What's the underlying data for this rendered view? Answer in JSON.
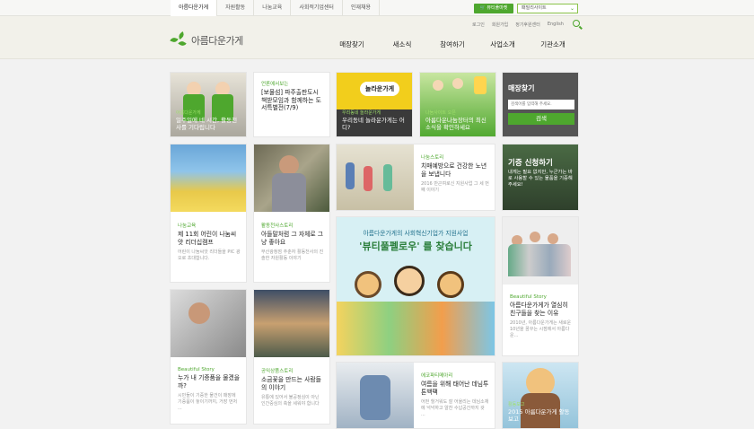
{
  "topbar": {
    "tabs": [
      "아름다운가게",
      "자원활동",
      "나눔교육",
      "사회적기업센터",
      "인재채용"
    ],
    "shop_label": "뷰티풀마켓",
    "site_select": "패밀리사이트"
  },
  "util": {
    "items": [
      "로그인",
      "회원가입",
      "정기후원센터",
      "English"
    ]
  },
  "logo": {
    "text": "아름다운가게"
  },
  "nav": {
    "items": [
      "매장찾기",
      "새소식",
      "참여하기",
      "사업소개",
      "기관소개"
    ]
  },
  "cards": {
    "c1": {
      "tag": "아름다운가게",
      "title": "일주일에 네 시간, 활동천사를 기다립니다"
    },
    "c2": {
      "cat": "언론에서보는",
      "title": "[보물섬] 파주출판도시 책받모임과 함께하는 도서특별전(7/9)"
    },
    "c3": {
      "brand": "놀라운가게",
      "tag": "우리동네 놀라운가게",
      "title": "우리동네 놀라운가게는 어디?"
    },
    "c4": {
      "tag": "나눔사이트 오픈",
      "title": "아름다운나눔장터의 최신 소식을 확인하세요"
    },
    "c5": {
      "title": "매장찾기",
      "placeholder": "검색어를 입력해 주세요.",
      "button": "검색"
    },
    "c6": {
      "cat": "나눔교육",
      "title": "제 11회 어린이 나눔씨앗 리더십캠프",
      "desc": "어린이 나눔씨앗 리더들을 PIC 광오로 초대합니다."
    },
    "c7": {
      "cat": "활동천사스토리",
      "title": "아들말처럼 그 자체로 그냥 좋아요",
      "desc": "부산광청점 추춘자 활동천사의 진솔한 자원활동 이야기"
    },
    "c8": {
      "cat": "나눔스토리",
      "title": "치매예방으로 건강한 노년을 보냅니다",
      "desc": "2016 반곤여로신 지원사업 그 세 번째 이야기"
    },
    "c9": {
      "title": "기증 신청하기",
      "desc": "내게는 필요 없지만, 누군가는 바로 사용할 수 있는 물품을 기증해주세요!"
    },
    "banner": {
      "line1": "아름다운가게의 사회혁신기업가 지원사업",
      "line2": "'뷰티풀펠로우' 를 찾습니다"
    },
    "c10": {
      "cat": "Beautiful Story",
      "title": "아름다운가게가 열심히 친구들을 찾는 이유",
      "desc": "2010년, 아름다운가게는 새로운 10년을 꿈꾸는 시점에서 아름다운..."
    },
    "c11": {
      "cat": "Beautiful Story",
      "title": "누가 내 기증품을 물겠을까?",
      "desc": "시민들이 기증한 물건이 매장에 기증품이 놓이기까지, 거장 먼처 ..."
    },
    "c12": {
      "cat": "공익상품스토리",
      "title": "소금꽃을 만드는 사람들의 이야기",
      "desc": "유통에 있어서 불공정심이 아닌 인간중심의 축을 세워야 합니다"
    },
    "c13": {
      "cat": "에코파티메아리",
      "title": "여름을 위해 태어난 데님투톤백팩",
      "desc": "어떤 헐거워도 잘 어울리는 데님소재에 넉넉하고 알찬 수납공간까지 갖 ..."
    },
    "c14": {
      "tag": "활동보고",
      "title": "2015 아름다운가게 활동보고"
    }
  }
}
